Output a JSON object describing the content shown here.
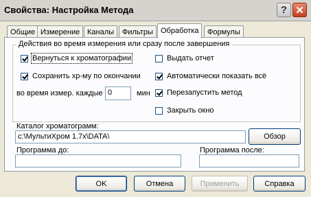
{
  "window": {
    "title": "Свойства: Настройка Метода",
    "help_glyph": "?",
    "close_glyph": "✕"
  },
  "tabs": [
    {
      "label": "Общие"
    },
    {
      "label": "Измерение"
    },
    {
      "label": "Каналы"
    },
    {
      "label": "Фильтры"
    },
    {
      "label": "Обработка"
    },
    {
      "label": "Формулы"
    }
  ],
  "active_tab": "Обработка",
  "group": {
    "label": "Действия во время измерения или сразу после завершения",
    "left": [
      {
        "label": "Вернуться к хроматографии",
        "checked": true
      },
      {
        "label": "Сохранить хр-му по окончании",
        "checked": true
      }
    ],
    "right": [
      {
        "label": "Выдать отчет",
        "checked": false
      },
      {
        "label": "Автоматически показать всё",
        "checked": true
      },
      {
        "label": "Перезапустить метод",
        "checked": true
      },
      {
        "label": "Закрыть окно",
        "checked": false
      }
    ],
    "interval": {
      "label": "во время измер. каждые",
      "value": "0",
      "unit": "мин"
    }
  },
  "catalog": {
    "label": "Каталог хроматограмм:",
    "value": "c:\\МультиХром 1.7x\\DATA\\",
    "browse_label": "Обзор"
  },
  "program_before": {
    "label": "Программа до:",
    "value": ""
  },
  "program_after": {
    "label": "Программа после:",
    "value": ""
  },
  "buttons": {
    "ok": "OK",
    "cancel": "Отмена",
    "apply": "Применить",
    "help": "Справка"
  }
}
